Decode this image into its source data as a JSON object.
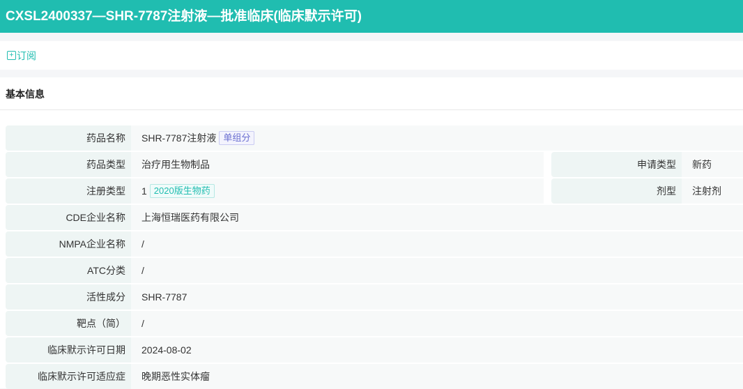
{
  "title": "CXSL2400337—SHR-7787注射液—批准临床(临床默示许可)",
  "subscribe": {
    "icon": "plus-square-icon",
    "label": "订阅"
  },
  "section_title": "基本信息",
  "rows": [
    {
      "label": "药品名称",
      "value": "SHR-7787注射液",
      "tag": "单组分"
    },
    {
      "label": "药品类型",
      "value": "治疗用生物制品"
    },
    {
      "label": "注册类型",
      "value": "1",
      "tag": "2020版生物药"
    },
    {
      "label": "CDE企业名称",
      "value": "上海恒瑞医药有限公司"
    },
    {
      "label": "NMPA企业名称",
      "value": "/"
    },
    {
      "label": "ATC分类",
      "value": "/"
    },
    {
      "label": "活性成分",
      "value": "SHR-7787"
    },
    {
      "label": "靶点（简）",
      "value": "/"
    },
    {
      "label": "临床默示许可日期",
      "value": "2024-08-02"
    },
    {
      "label": "临床默示许可适应症",
      "value": "晚期恶性实体瘤"
    }
  ],
  "right": [
    {
      "label": "申请类型",
      "value": "新药"
    },
    {
      "label": "剂型",
      "value": "注射剂"
    }
  ],
  "colors": {
    "accent": "#20bdb0"
  }
}
